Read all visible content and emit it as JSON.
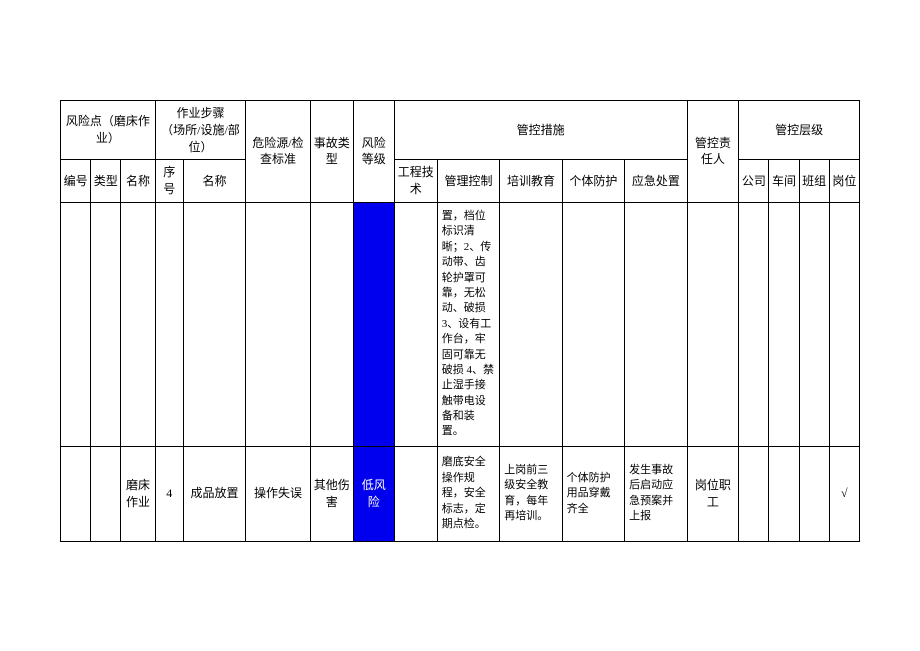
{
  "headers": {
    "risk_point": "风险点（磨床作业）",
    "step_group": "作业步骤\n（场所/设施/部位）",
    "hazard": "危险源/检查标准",
    "accident_type": "事故类型",
    "risk_level": "风险等级",
    "control_measures": "管控措施",
    "responsible": "管控责任人",
    "control_level": "管控层级",
    "no": "编号",
    "type": "类型",
    "name": "名称",
    "seq": "序号",
    "step_name": "名称",
    "engineering": "工程技术",
    "management": "管理控制",
    "training": "培训教育",
    "ppe": "个体防护",
    "emergency": "应急处置",
    "company": "公司",
    "workshop": "车间",
    "team": "班组",
    "post": "岗位"
  },
  "rows": {
    "r1": {
      "no": "",
      "type": "",
      "name": "",
      "seq": "",
      "step_name": "",
      "hazard": "",
      "accident_type": "",
      "risk_level": "",
      "engineering": "",
      "management": "置，档位标识清晰；2、传动带、齿轮护罩可靠，无松动、破损 3、设有工作台，牢固可靠无破损 4、禁止湿手接触带电设备和装置。",
      "training": "",
      "ppe": "",
      "emergency": "",
      "responsible": "",
      "company": "",
      "workshop": "",
      "team": "",
      "post": ""
    },
    "r2": {
      "no": "",
      "type": "",
      "name": "磨床作业",
      "seq": "4",
      "step_name": "成品放置",
      "hazard": "操作失误",
      "accident_type": "其他伤害",
      "risk_level": "低风险",
      "engineering": "",
      "management": "磨底安全操作规程，安全标志，定期点检。",
      "training": "上岗前三级安全教育，每年再培训。",
      "ppe": "个体防护用品穿戴齐全",
      "emergency": "发生事故后启动应急预案并上报",
      "responsible": "岗位职工",
      "company": "",
      "workshop": "",
      "team": "",
      "post": "√"
    }
  }
}
